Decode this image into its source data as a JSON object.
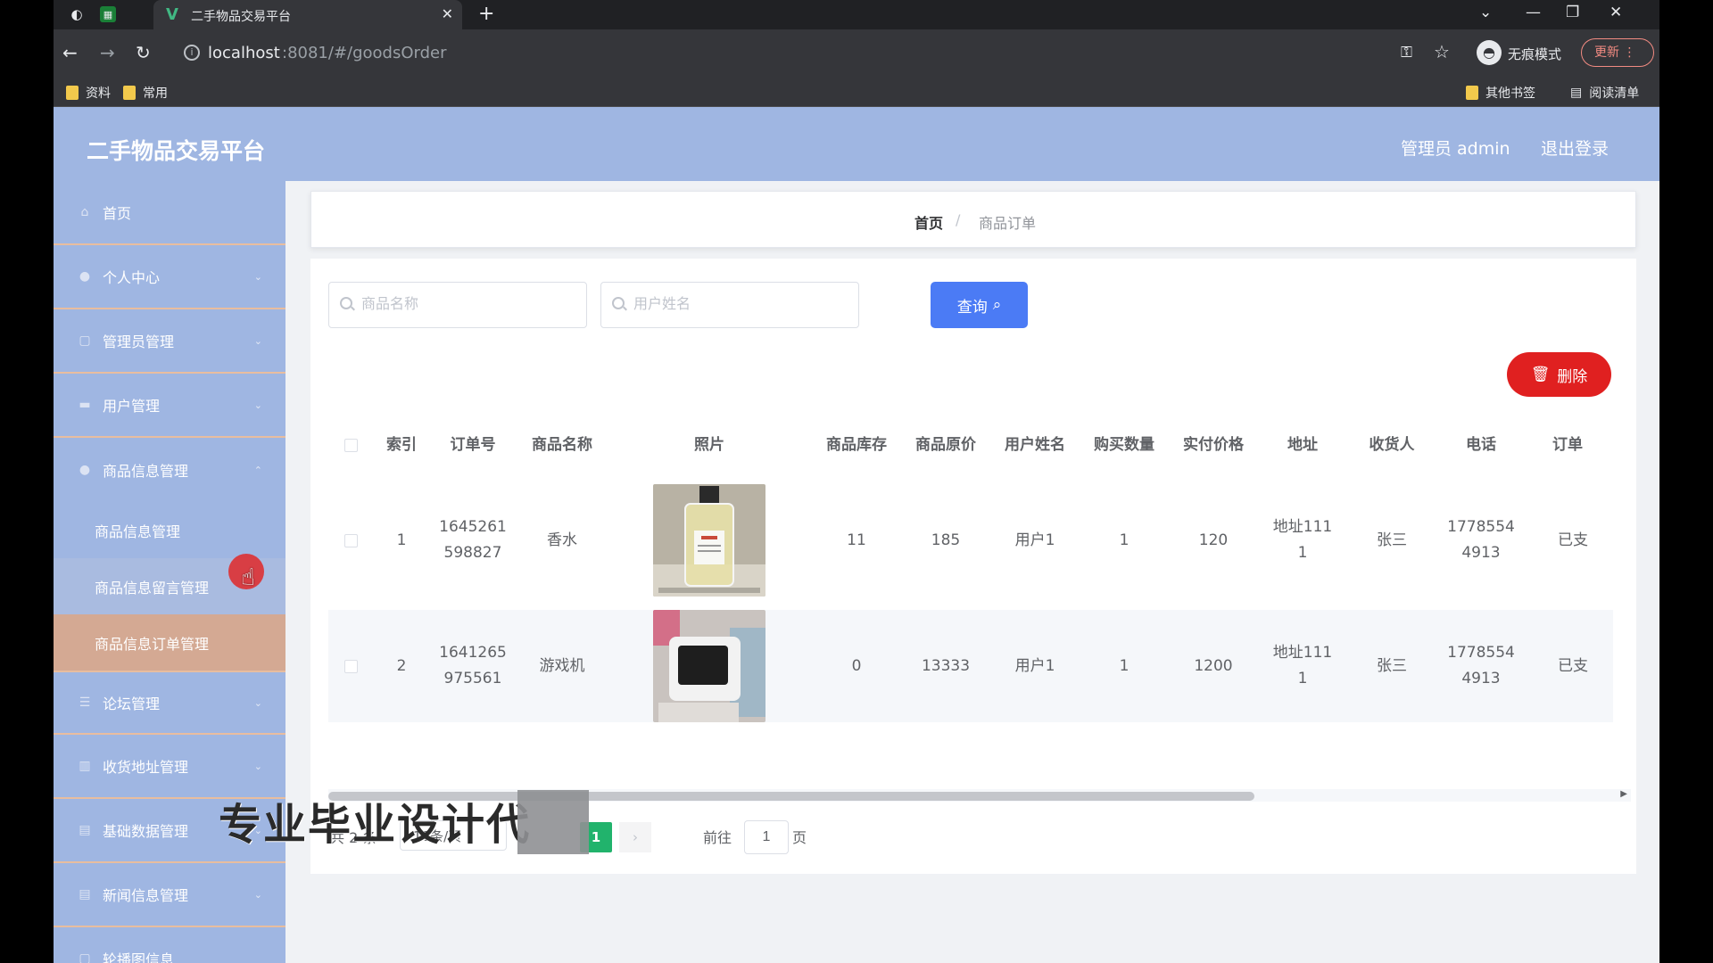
{
  "browser": {
    "tab_title": "二手物品交易平台",
    "url_host": "localhost",
    "url_path": ":8081/#/goodsOrder",
    "incognito_label": "无痕模式",
    "update_label": "更新",
    "bookmarks": [
      "资料",
      "常用"
    ],
    "bookmarks_right": [
      "其他书签",
      "阅读清单"
    ]
  },
  "header": {
    "app_title": "二手物品交易平台",
    "admin_label": "管理员 admin",
    "logout_label": "退出登录"
  },
  "sidebar": {
    "items": [
      {
        "label": "首页",
        "icon": "home-icon"
      },
      {
        "label": "个人中心",
        "icon": "user-icon"
      },
      {
        "label": "管理员管理",
        "icon": "admin-icon"
      },
      {
        "label": "用户管理",
        "icon": "users-icon"
      },
      {
        "label": "商品信息管理",
        "icon": "goods-icon"
      }
    ],
    "sub_items": [
      "商品信息管理",
      "商品信息留言管理",
      "商品信息订单管理"
    ],
    "items_after": [
      {
        "label": "论坛管理",
        "icon": "forum-icon"
      },
      {
        "label": "收货地址管理",
        "icon": "chart-icon"
      },
      {
        "label": "基础数据管理",
        "icon": "data-icon"
      },
      {
        "label": "新闻信息管理",
        "icon": "news-icon"
      },
      {
        "label": "轮播图信息",
        "icon": "carousel-icon"
      }
    ]
  },
  "breadcrumb": {
    "home": "首页",
    "separator": "/",
    "current": "商品订单"
  },
  "search": {
    "goods_placeholder": "商品名称",
    "user_placeholder": "用户姓名",
    "query_label": "查询"
  },
  "actions": {
    "delete_label": "删除"
  },
  "table": {
    "columns": [
      "索引",
      "订单号",
      "商品名称",
      "照片",
      "商品库存",
      "商品原价",
      "用户姓名",
      "购买数量",
      "实付价格",
      "地址",
      "收货人",
      "电话",
      "订单"
    ],
    "rows": [
      {
        "index": "1",
        "order_no": "1645261598827",
        "goods_name": "香水",
        "photo": "perfume-photo",
        "stock": "11",
        "original_price": "185",
        "user_name": "用户1",
        "quantity": "1",
        "paid_price": "120",
        "address": "地址1111",
        "receiver": "张三",
        "phone": "17785544913",
        "status": "已支"
      },
      {
        "index": "2",
        "order_no": "1641265975561",
        "goods_name": "游戏机",
        "photo": "game-console-photo",
        "stock": "0",
        "original_price": "13333",
        "user_name": "用户1",
        "quantity": "1",
        "paid_price": "1200",
        "address": "地址1111",
        "receiver": "张三",
        "phone": "17785544913",
        "status": "已支"
      }
    ]
  },
  "pagination": {
    "total": "共 2 条",
    "page_size": "10条/页",
    "current_page": "1",
    "goto_label": "前往",
    "goto_value": "1",
    "page_unit": "页"
  },
  "overlay": {
    "watermark": "专业毕业设计代"
  },
  "colors": {
    "header_bg": "#9fb6e2",
    "query_button": "#4b7bf5",
    "delete_button": "#e02020",
    "active_page": "#21b36c",
    "selected_menu": "#d4a993"
  }
}
